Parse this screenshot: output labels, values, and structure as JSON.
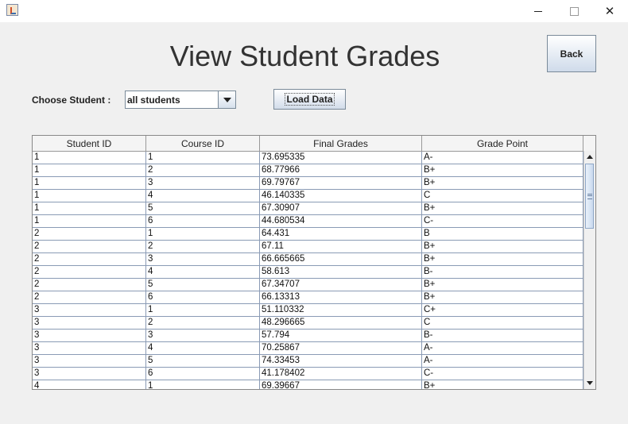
{
  "window": {
    "title": "",
    "icons": {
      "app": "java-app-icon",
      "minimize": "minimize-icon",
      "maximize": "maximize-icon",
      "close": "close-icon"
    },
    "close_glyph": "✕"
  },
  "page": {
    "title": "View Student Grades"
  },
  "toolbar": {
    "back_label": "Back",
    "choose_label": "Choose Student :",
    "student_select_value": "all students",
    "load_label": "Load Data"
  },
  "table": {
    "columns": [
      "Student ID",
      "Course ID",
      "Final Grades",
      "Grade Point"
    ],
    "rows": [
      [
        "1",
        "1",
        "73.695335",
        "A-"
      ],
      [
        "1",
        "2",
        "68.77966",
        "B+"
      ],
      [
        "1",
        "3",
        "69.79767",
        "B+"
      ],
      [
        "1",
        "4",
        "46.140335",
        "C"
      ],
      [
        "1",
        "5",
        "67.30907",
        "B+"
      ],
      [
        "1",
        "6",
        "44.680534",
        "C-"
      ],
      [
        "2",
        "1",
        "64.431",
        "B"
      ],
      [
        "2",
        "2",
        "67.11",
        "B+"
      ],
      [
        "2",
        "3",
        "66.665665",
        "B+"
      ],
      [
        "2",
        "4",
        "58.613",
        "B-"
      ],
      [
        "2",
        "5",
        "67.34707",
        "B+"
      ],
      [
        "2",
        "6",
        "66.13313",
        "B+"
      ],
      [
        "3",
        "1",
        "51.110332",
        "C+"
      ],
      [
        "3",
        "2",
        "48.296665",
        "C"
      ],
      [
        "3",
        "3",
        "57.794",
        "B-"
      ],
      [
        "3",
        "4",
        "70.25867",
        "A-"
      ],
      [
        "3",
        "5",
        "74.33453",
        "A-"
      ],
      [
        "3",
        "6",
        "41.178402",
        "C-"
      ],
      [
        "4",
        "1",
        "69.39667",
        "B+"
      ]
    ]
  },
  "colors": {
    "accent": "#8a9bb5",
    "button_gradient_bottom": "#cfdbea"
  }
}
